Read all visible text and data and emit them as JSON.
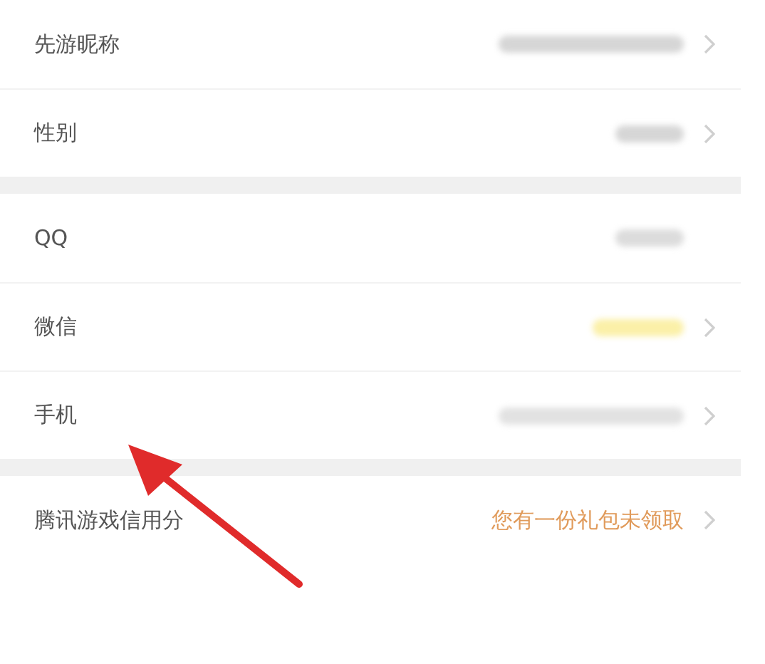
{
  "groups": [
    {
      "rows": [
        {
          "label": "先游昵称",
          "value": {
            "kind": "wide",
            "color": "#d6d6d6"
          },
          "chevron": true
        },
        {
          "label": "性别",
          "value": {
            "kind": "narrow",
            "color": "#d6d6d6"
          },
          "chevron": true
        }
      ]
    },
    {
      "rows": [
        {
          "label": "QQ",
          "value": {
            "kind": "narrow",
            "color": "#dcdcdc"
          },
          "chevron": false
        },
        {
          "label": "微信",
          "value": {
            "kind": "medium",
            "color": "#fbf0a8"
          },
          "chevron": true
        },
        {
          "label": "手机",
          "value": {
            "kind": "wide",
            "color": "#e2e2e2"
          },
          "chevron": true
        }
      ]
    },
    {
      "rows": [
        {
          "label": "腾讯游戏信用分",
          "value": {
            "kind": "text",
            "text": "您有一份礼包未领取"
          },
          "chevron": true
        }
      ]
    }
  ],
  "annotation": {
    "kind": "arrow"
  }
}
